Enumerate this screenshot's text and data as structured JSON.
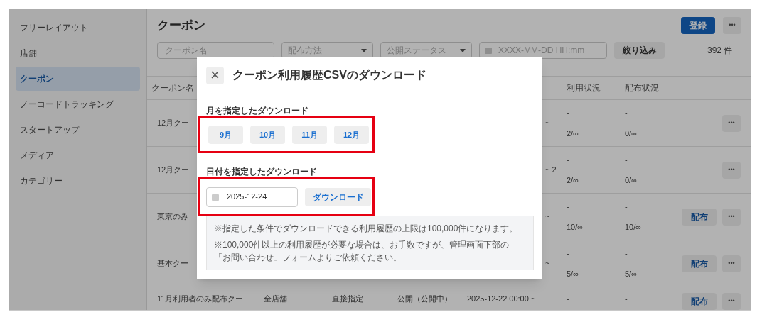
{
  "sidebar": {
    "items": [
      {
        "label": "フリーレイアウト",
        "selected": false
      },
      {
        "label": "店舗",
        "selected": false
      },
      {
        "label": "クーポン",
        "selected": true
      },
      {
        "label": "ノーコードトラッキング",
        "selected": false
      },
      {
        "label": "スタートアップ",
        "selected": false
      },
      {
        "label": "メディア",
        "selected": false
      },
      {
        "label": "カテゴリー",
        "selected": false
      }
    ]
  },
  "header": {
    "title": "クーポン",
    "register_button": "登録",
    "more_button": "•••"
  },
  "filters": {
    "name_placeholder": "クーポン名",
    "method_placeholder": "配布方法",
    "status_placeholder": "公開ステータス",
    "date_placeholder": "XXXX-MM-DD HH:mm",
    "filter_button": "絞り込み",
    "count": "392 件"
  },
  "table": {
    "columns": [
      {
        "label": "クーポン名"
      },
      {
        "label": "利用状況"
      },
      {
        "label": "配布状況"
      }
    ],
    "rows": [
      {
        "kind": "partial",
        "name": "12月クー",
        "period": "~",
        "usage": [
          "-",
          "2/∞"
        ],
        "distribution": [
          "-",
          "0/∞"
        ],
        "actions": [
          "•••"
        ]
      },
      {
        "kind": "partial",
        "name": "12月クー",
        "period": "~ 2",
        "usage": [
          "-",
          "2/∞"
        ],
        "distribution": [
          "-",
          "0/∞"
        ],
        "actions": [
          "•••"
        ]
      },
      {
        "kind": "partial",
        "name": "東京のみ",
        "period": "~",
        "usage": [
          "-",
          "10/∞"
        ],
        "distribution": [
          "-",
          "10/∞"
        ],
        "actions": [
          "配布",
          "•••"
        ]
      },
      {
        "kind": "partial",
        "name": "基本クー",
        "period": "~",
        "usage": [
          "-",
          "5/∞"
        ],
        "distribution": [
          "-",
          "5/∞"
        ],
        "actions": [
          "配布",
          "•••"
        ]
      },
      {
        "kind": "full",
        "name": "11月利用者のみ配布クー",
        "store": "全店舗",
        "method": "直接指定",
        "status": "公開（公開中）",
        "period": "2025-12-22 00:00 ~",
        "usage": [
          "-"
        ],
        "distribution": [
          "-"
        ],
        "actions": [
          "配布",
          "•••"
        ]
      }
    ]
  },
  "modal": {
    "close": "×",
    "title": "クーポン利用履歴CSVのダウンロード",
    "month_section": {
      "label": "月を指定したダウンロード",
      "highlighted": true,
      "months": [
        "9月",
        "10月",
        "11月",
        "12月"
      ]
    },
    "date_section": {
      "label": "日付を指定したダウンロード",
      "highlighted": true,
      "date_value": "2025-12-24",
      "download_button": "ダウンロード"
    },
    "notes": [
      "※指定した条件でダウンロードできる利用履歴の上限は100,000件になります。",
      "※100,000件以上の利用履歴が必要な場合は、お手数ですが、管理画面下部の「お問い合わせ」フォームよりご依頼ください。"
    ]
  }
}
